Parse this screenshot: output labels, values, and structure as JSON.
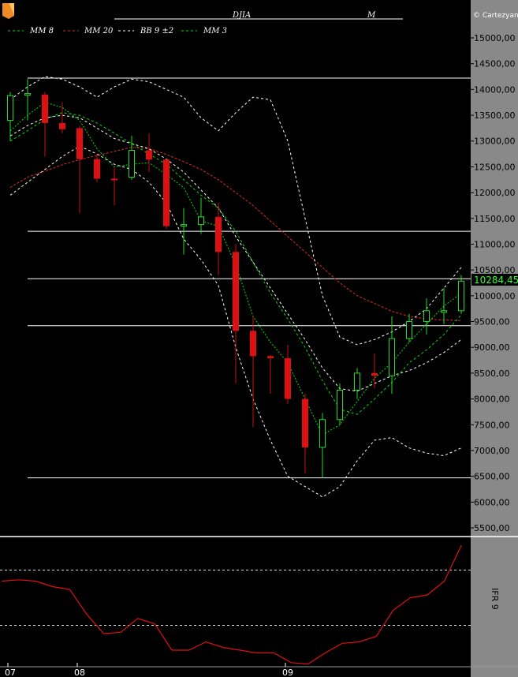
{
  "chart_data": [
    {
      "type": "candlestick",
      "title": "DJIA",
      "period": "M",
      "watermark": "© Cartezyan",
      "ylim": [
        5000,
        15500
      ],
      "y_ticks": [
        "15000,00",
        "14500,00",
        "14000,00",
        "13500,00",
        "13000,00",
        "12500,00",
        "12000,00",
        "11500,00",
        "11000,00",
        "10500,00",
        "10000,00",
        "9500,00",
        "9000,00",
        "8500,00",
        "8000,00",
        "7500,00",
        "7000,00",
        "6500,00",
        "6000,00",
        "5500,00"
      ],
      "y_tick_values": [
        15000,
        14500,
        14000,
        13500,
        13000,
        12500,
        12000,
        11500,
        11000,
        10500,
        10000,
        9500,
        9000,
        8500,
        8000,
        7500,
        7000,
        6500,
        6000,
        5500
      ],
      "x_ticks": [
        {
          "label": "07",
          "index": 0
        },
        {
          "label": "08",
          "index": 4
        },
        {
          "label": "09",
          "index": 16
        }
      ],
      "last_price": "10284,45",
      "last_price_value": 10284.45,
      "hlines": [
        14220,
        11250,
        10330,
        9420,
        6470
      ],
      "legend": [
        {
          "label": "MM  8",
          "color": "#00e000",
          "dash": "dash"
        },
        {
          "label": "MM 20",
          "color": "#dd2a2a",
          "dash": "dash"
        },
        {
          "label": "BB  9 ±2",
          "color": "#ffffff",
          "dash": "dash"
        },
        {
          "label": "MM  3",
          "color": "#00e000",
          "dash": "dash"
        }
      ],
      "candles": [
        {
          "o": 13400,
          "h": 13950,
          "l": 13000,
          "c": 13880
        },
        {
          "o": 13900,
          "h": 14200,
          "l": 13400,
          "c": 13920
        },
        {
          "o": 13900,
          "h": 13950,
          "l": 12700,
          "c": 13350
        },
        {
          "o": 13350,
          "h": 13750,
          "l": 13150,
          "c": 13230
        },
        {
          "o": 13250,
          "h": 13300,
          "l": 11600,
          "c": 12650
        },
        {
          "o": 12650,
          "h": 12750,
          "l": 12200,
          "c": 12270
        },
        {
          "o": 12270,
          "h": 12500,
          "l": 11750,
          "c": 12260
        },
        {
          "o": 12300,
          "h": 13100,
          "l": 12250,
          "c": 12820
        },
        {
          "o": 12820,
          "h": 13150,
          "l": 12400,
          "c": 12640
        },
        {
          "o": 12640,
          "h": 12650,
          "l": 11300,
          "c": 11350
        },
        {
          "o": 11350,
          "h": 11700,
          "l": 10800,
          "c": 11380
        },
        {
          "o": 11380,
          "h": 11900,
          "l": 11200,
          "c": 11530
        },
        {
          "o": 11530,
          "h": 11800,
          "l": 10400,
          "c": 10850
        },
        {
          "o": 10850,
          "h": 11000,
          "l": 8300,
          "c": 9320
        },
        {
          "o": 9320,
          "h": 9600,
          "l": 7450,
          "c": 8830
        },
        {
          "o": 8830,
          "h": 8850,
          "l": 8100,
          "c": 8790
        },
        {
          "o": 8790,
          "h": 9050,
          "l": 7900,
          "c": 8000
        },
        {
          "o": 8000,
          "h": 8100,
          "l": 6550,
          "c": 7060
        },
        {
          "o": 7060,
          "h": 7730,
          "l": 6470,
          "c": 7600
        },
        {
          "o": 7600,
          "h": 8300,
          "l": 7500,
          "c": 8170
        },
        {
          "o": 8170,
          "h": 8600,
          "l": 8000,
          "c": 8500
        },
        {
          "o": 8500,
          "h": 8880,
          "l": 8200,
          "c": 8450
        },
        {
          "o": 8450,
          "h": 9600,
          "l": 8100,
          "c": 9170
        },
        {
          "o": 9170,
          "h": 9650,
          "l": 9100,
          "c": 9500
        },
        {
          "o": 9500,
          "h": 9950,
          "l": 9250,
          "c": 9710
        },
        {
          "o": 9710,
          "h": 10150,
          "l": 9450,
          "c": 9710
        },
        {
          "o": 9710,
          "h": 10400,
          "l": 9650,
          "c": 10284
        }
      ],
      "mm8": [
        13000,
        13200,
        13420,
        13550,
        13500,
        13350,
        13150,
        12950,
        12750,
        12550,
        12250,
        11950,
        11700,
        11250,
        10650,
        10050,
        9550,
        9000,
        8350,
        7800,
        7700,
        8000,
        8320,
        8700,
        8950,
        9250,
        9630
      ],
      "mm20": [
        12100,
        12300,
        12420,
        12540,
        12640,
        12720,
        12800,
        12880,
        12850,
        12740,
        12600,
        12450,
        12250,
        12000,
        11750,
        11450,
        11150,
        10850,
        10550,
        10250,
        10000,
        9850,
        9700,
        9600,
        9550,
        9530,
        9520
      ],
      "bb_upper": [
        13800,
        14050,
        14250,
        14200,
        14050,
        13850,
        14050,
        14200,
        14150,
        14000,
        13850,
        13450,
        13200,
        13550,
        13850,
        13800,
        13000,
        11500,
        10000,
        9200,
        9050,
        9150,
        9300,
        9500,
        9750,
        10150,
        10550
      ],
      "bb_mid": [
        13100,
        13300,
        13450,
        13500,
        13450,
        13250,
        13050,
        12950,
        12850,
        12650,
        12400,
        12050,
        11700,
        11150,
        10650,
        10150,
        9650,
        9150,
        8600,
        8200,
        8150,
        8300,
        8450,
        8550,
        8700,
        8900,
        9150
      ],
      "bb_lower": [
        11950,
        12200,
        12450,
        12700,
        12900,
        12750,
        12550,
        12450,
        12200,
        11800,
        11100,
        10700,
        10200,
        9000,
        8000,
        7200,
        6500,
        6300,
        6100,
        6300,
        6800,
        7200,
        7250,
        7050,
        6950,
        6900,
        7050
      ],
      "mm3": [
        13200,
        13500,
        13750,
        13650,
        13400,
        12850,
        12500,
        12550,
        12580,
        12350,
        12100,
        11450,
        11350,
        10600,
        9600,
        9100,
        8700,
        8000,
        7300,
        7500,
        7950,
        8400,
        8700,
        9100,
        9450,
        9800,
        10050
      ]
    },
    {
      "type": "line",
      "title": "IFR 9",
      "ylim": [
        0,
        100
      ],
      "guides": [
        70,
        30
      ],
      "values": [
        62,
        63,
        62,
        58,
        56,
        38,
        24,
        25,
        35,
        31,
        12,
        12,
        18,
        14,
        12,
        10,
        10,
        3,
        2,
        10,
        17,
        18,
        22,
        41,
        50,
        52,
        62,
        88
      ]
    }
  ]
}
